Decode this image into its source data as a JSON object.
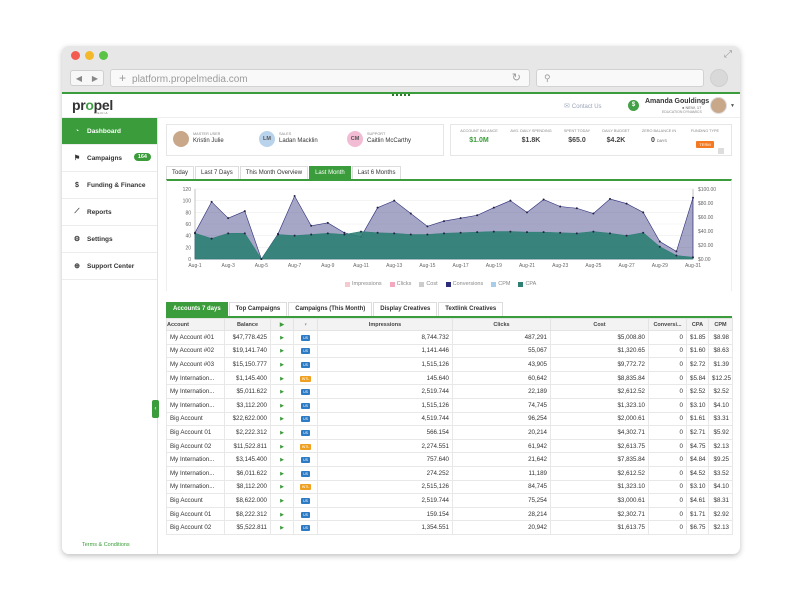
{
  "browser": {
    "url": "platform.propelmedia.com"
  },
  "header": {
    "logo": "propel",
    "logo_sub": "MEDIA",
    "contact_us": "Contact Us",
    "dollar": "$",
    "user_name": "Amanda Gouldings",
    "user_status": "● NEW, 17",
    "user_company": "EDUCATION DYNAMICS"
  },
  "sidebar": {
    "items": [
      {
        "label": "Dashboard",
        "icon": "gauge-icon",
        "glyph": "◔"
      },
      {
        "label": "Campaigns",
        "icon": "flag-icon",
        "glyph": "⚑",
        "badge": "164"
      },
      {
        "label": "Funding & Finance",
        "icon": "dollar-icon",
        "glyph": "$"
      },
      {
        "label": "Reports",
        "icon": "line-chart-icon",
        "glyph": "⟋"
      },
      {
        "label": "Settings",
        "icon": "gear-icon",
        "glyph": "⚙"
      },
      {
        "label": "Support Center",
        "icon": "lifebuoy-icon",
        "glyph": "⊕"
      }
    ],
    "terms": "Terms & Conditions"
  },
  "contacts": [
    {
      "role": "MASTER USER",
      "name": "Kristin  Julie",
      "initials": "",
      "color": "#c9a88a"
    },
    {
      "role": "SALES",
      "name": "Ladan Macklin",
      "initials": "LM",
      "color": "#b9d3ec"
    },
    {
      "role": "SUPPORT",
      "name": "Caitlin McCarthy",
      "initials": "CM",
      "color": "#f2bcd4"
    }
  ],
  "stats": [
    {
      "label": "ACCOUNT BALANCE",
      "value": "$1.0M",
      "green": true
    },
    {
      "label": "AVG. DAILY SPENDING",
      "value": "$1.8K"
    },
    {
      "label": "SPENT TODAY",
      "value": "$65.0"
    },
    {
      "label": "DAILY BUDGET",
      "value": "$4.2K"
    },
    {
      "label": "ZERO BALANCE IN",
      "value": "0",
      "unit": "DAYS"
    },
    {
      "label": "FUNDING TYPE",
      "badge": "TERM"
    }
  ],
  "chart_tabs": [
    "Today",
    "Last 7 Days",
    "This Month Overview",
    "Last Month",
    "Last 6 Months"
  ],
  "chart_tab_active": 3,
  "chart_data": {
    "type": "area",
    "x": [
      "Aug-1",
      "Aug-3",
      "Aug-5",
      "Aug-7",
      "Aug-9",
      "Aug-11",
      "Aug-13",
      "Aug-15",
      "Aug-17",
      "Aug-19",
      "Aug-21",
      "Aug-23",
      "Aug-25",
      "Aug-27",
      "Aug-29",
      "Aug-31"
    ],
    "x_points": 31,
    "left_axis": {
      "ticks": [
        0,
        20,
        40,
        60,
        80,
        100,
        120
      ],
      "ylim": [
        0,
        120
      ]
    },
    "right_axis": {
      "ticks": [
        "$0.00",
        "$20.00",
        "$40.00",
        "$60.00",
        "$80.00",
        "$100.00"
      ],
      "ylim": [
        0,
        100
      ]
    },
    "series": [
      {
        "name": "Impressions",
        "color": "#f7c9cf",
        "values": []
      },
      {
        "name": "Clicks",
        "color": "#f4a8bd",
        "values": []
      },
      {
        "name": "Cost",
        "color": "#cccccc",
        "values": []
      },
      {
        "name": "Conversions",
        "color": "#2c2c7a",
        "values": [
          45,
          98,
          70,
          82,
          0,
          43,
          108,
          57,
          62,
          45,
          38,
          88,
          100,
          78,
          56,
          65,
          70,
          75,
          88,
          100,
          80,
          102,
          90,
          87,
          78,
          103,
          95,
          80,
          30,
          13,
          105
        ]
      },
      {
        "name": "CPM",
        "color": "#a8cde8",
        "values": []
      },
      {
        "name": "CPA",
        "color": "#2e8074",
        "values": [
          44,
          35,
          44,
          44,
          0,
          42,
          40,
          42,
          44,
          42,
          47,
          45,
          44,
          42,
          42,
          44,
          45,
          46,
          47,
          47,
          46,
          46,
          45,
          44,
          47,
          44,
          40,
          45,
          21,
          6,
          3
        ]
      }
    ],
    "legend": [
      "Impressions",
      "Clicks",
      "Cost",
      "Conversions",
      "CPM",
      "CPA"
    ],
    "legend_placement": "bottom"
  },
  "table_tabs": [
    "Accounts 7 days",
    "Top Campaigns",
    "Campaigns (This Month)",
    "Display Creatives",
    "Textlink Creatives"
  ],
  "table_tab_active": 0,
  "table": {
    "headers": [
      "Account",
      "Balance",
      "▶",
      "♀",
      "Impressions",
      "Clicks",
      "Cost",
      "Conversi...",
      "CPA",
      "CPM"
    ],
    "rows": [
      [
        "My Account #01",
        "$47,778.425",
        "US",
        "8,744.732",
        "487,291",
        "$5,008.80",
        "0",
        "$1.85",
        "$8.98"
      ],
      [
        "My Account #02",
        "$19,141.740",
        "US",
        "1,141.446",
        "55,067",
        "$1,320.65",
        "0",
        "$1.60",
        "$8.63"
      ],
      [
        "My Account #03",
        "$15,150.777",
        "US",
        "1,515,126",
        "43,905",
        "$9,772.72",
        "0",
        "$2.72",
        "$1.39"
      ],
      [
        "My Internation...",
        "$1,145.400",
        "INTL",
        "145.640",
        "60,642",
        "$8,835.84",
        "0",
        "$5.84",
        "$12.25"
      ],
      [
        "My Internation...",
        "$5,011.622",
        "US",
        "2,519.744",
        "22,189",
        "$2,612.52",
        "0",
        "$2.52",
        "$2.52"
      ],
      [
        "My Internation...",
        "$3,112.200",
        "US",
        "1,515,126",
        "74,745",
        "$1,323.10",
        "0",
        "$3.10",
        "$4.10"
      ],
      [
        "Big Account",
        "$22,622.000",
        "US",
        "4,519.744",
        "96,254",
        "$2,000.61",
        "0",
        "$1.61",
        "$3.31"
      ],
      [
        "Big Account 01",
        "$2,222.312",
        "US",
        "566.154",
        "20,214",
        "$4,302.71",
        "0",
        "$2.71",
        "$5.92"
      ],
      [
        "Big Account 02",
        "$11,522.811",
        "INTL",
        "2,274.551",
        "61,942",
        "$2,613.75",
        "0",
        "$4.75",
        "$2.13"
      ],
      [
        "My Internation...",
        "$3,145.400",
        "US",
        "757.640",
        "21,642",
        "$7,835.84",
        "0",
        "$4.84",
        "$9.25"
      ],
      [
        "My Internation...",
        "$6,011.622",
        "US",
        "274.252",
        "11,189",
        "$2,612.52",
        "0",
        "$4.52",
        "$3.52"
      ],
      [
        "My Internation...",
        "$8,112.200",
        "INTL",
        "2,515,126",
        "84,745",
        "$1,323.10",
        "0",
        "$3.10",
        "$4.10"
      ],
      [
        "Big Account",
        "$8,622.000",
        "US",
        "2,519.744",
        "75,254",
        "$3,000.61",
        "0",
        "$4.61",
        "$8.31"
      ],
      [
        "Big Account 01",
        "$8,222.312",
        "US",
        "159.154",
        "28,214",
        "$2,302.71",
        "0",
        "$1.71",
        "$2.92"
      ],
      [
        "Big Account 02",
        "$5,522.811",
        "US",
        "1,354.551",
        "20,942",
        "$1,613.75",
        "0",
        "$6.75",
        "$2.13"
      ]
    ]
  }
}
